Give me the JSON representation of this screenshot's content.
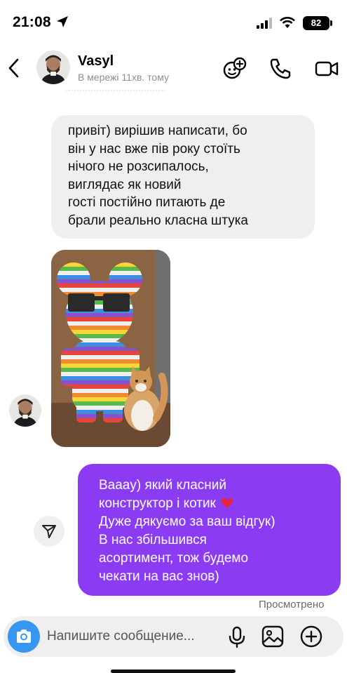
{
  "status_bar": {
    "time": "21:08",
    "battery": "82",
    "icons": [
      "location-arrow-icon",
      "cellular-signal-icon",
      "wifi-icon",
      "battery-icon"
    ]
  },
  "header": {
    "contact_name": "Vasyl",
    "contact_status": "В мережі 11хв. тому",
    "icons": [
      "back-icon",
      "effects-icon",
      "phone-icon",
      "video-icon"
    ]
  },
  "messages": {
    "incoming_lines": [
      "привіт) вирішив написати, бо",
      "він у нас вже пів року стоїть",
      "нічого не розсипалось,",
      "виглядає як новий",
      "гості постійно питають де",
      "брали реально класна штука"
    ],
    "outgoing_lines": [
      "Ваааy) який класний",
      "конструктор і котик",
      "Дуже дякуємо за ваш відгук)",
      "В нас збільшився",
      "асортимент, тож будемо",
      "чекати на вас знов)"
    ],
    "seen_label": "Просмотрено"
  },
  "composer": {
    "placeholder": "Напишите сообщение...",
    "icons": [
      "camera-icon",
      "microphone-icon",
      "gallery-icon",
      "add-icon"
    ]
  },
  "colors": {
    "outgoing_bubble": "#8b3cf2",
    "incoming_bubble": "#efefef",
    "camera_button": "#3797f0"
  }
}
